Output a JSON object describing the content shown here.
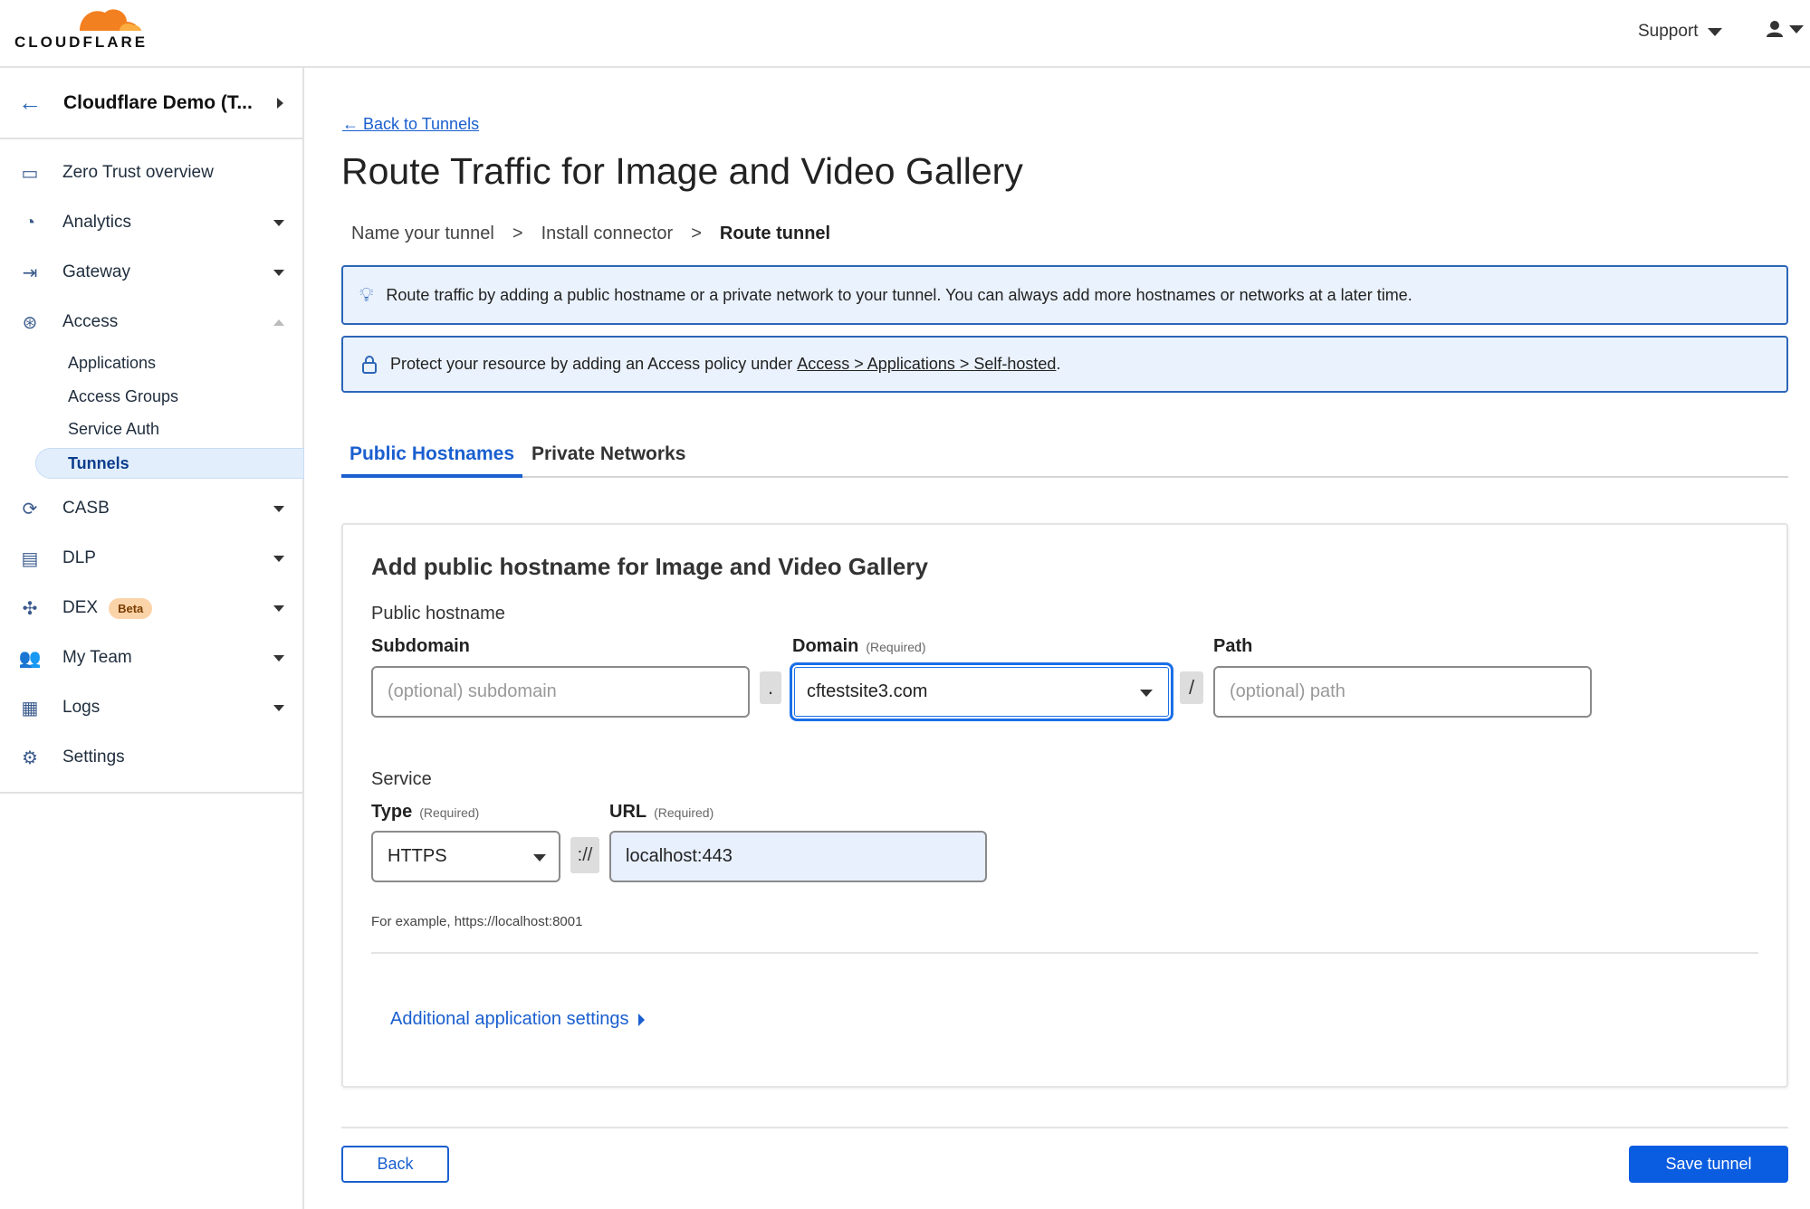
{
  "header": {
    "logo_text": "CLOUDFLARE",
    "support_label": "Support"
  },
  "sidebar": {
    "account": "Cloudflare Demo (T...",
    "items": [
      {
        "label": "Zero Trust overview",
        "icon": "browser-window-icon"
      },
      {
        "label": "Analytics",
        "icon": "pie-chart-icon"
      },
      {
        "label": "Gateway",
        "icon": "gateway-icon"
      },
      {
        "label": "Access",
        "icon": "access-icon"
      },
      {
        "label": "CASB",
        "icon": "casb-icon"
      },
      {
        "label": "DLP",
        "icon": "dlp-icon"
      },
      {
        "label": "DEX",
        "icon": "dex-icon",
        "badge": "Beta"
      },
      {
        "label": "My Team",
        "icon": "team-icon"
      },
      {
        "label": "Logs",
        "icon": "logs-icon"
      },
      {
        "label": "Settings",
        "icon": "gear-icon"
      }
    ],
    "access_sub": [
      "Applications",
      "Access Groups",
      "Service Auth",
      "Tunnels"
    ],
    "active": "Tunnels"
  },
  "main": {
    "back_link": "← Back to Tunnels",
    "title": "Route Traffic for Image and Video Gallery",
    "steps": [
      "Name your tunnel",
      ">",
      "Install connector",
      ">",
      "Route tunnel"
    ],
    "info": "Route traffic by adding a public hostname or a private network to your tunnel. You can always add more hostnames or networks at a later time.",
    "protect_text": "Protect your resource by adding an Access policy under ",
    "protect_link": "Access > Applications > Self-hosted",
    "protect_end": ".",
    "tabs": [
      "Public Hostnames",
      "Private Networks"
    ],
    "active_tab": "Public Hostnames",
    "card": {
      "heading": "Add public hostname for Image and Video Gallery",
      "public_hostname": "Public hostname",
      "subdomain_label": "Subdomain",
      "subdomain_placeholder": "(optional) subdomain",
      "dot": ".",
      "domain_label": "Domain",
      "required": "(Required)",
      "domain_value": "cftestsite3.com",
      "slash": "/",
      "path_label": "Path",
      "path_placeholder": "(optional) path",
      "service": "Service",
      "type_label": "Type",
      "type_value": "HTTPS",
      "scheme_sep": "://",
      "url_label": "URL",
      "url_value": "localhost:443",
      "example": "For example, https://localhost:8001",
      "additional": "Additional application settings"
    },
    "back_button": "Back",
    "save_button": "Save tunnel"
  },
  "colors": {
    "accent": "#1a5fcf",
    "primary_button": "#0a5ce0",
    "info_bg": "#eaf2fd",
    "brand_orange": "#f38020"
  }
}
